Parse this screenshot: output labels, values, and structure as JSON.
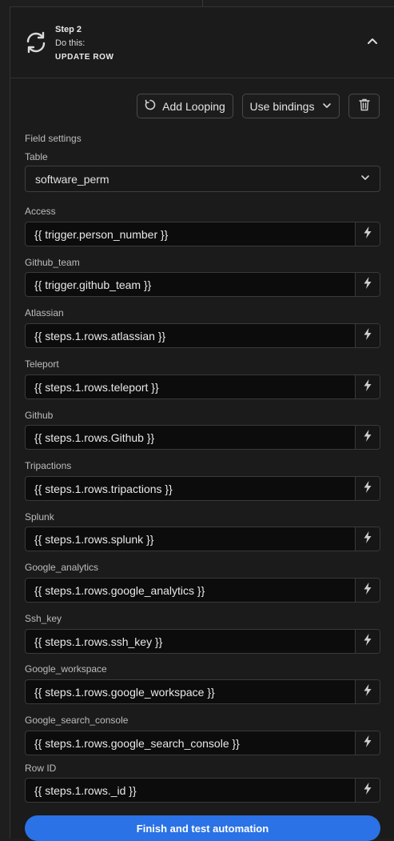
{
  "step": {
    "number_label": "Step 2",
    "do_label": "Do this:",
    "action_label": "UPDATE ROW",
    "icon": "refresh-icon",
    "collapse_icon": "chevron-up-icon"
  },
  "toolbar": {
    "looping_label": "Add Looping",
    "bindings_label": "Use bindings",
    "delete_icon": "trash-icon"
  },
  "settings": {
    "section_title": "Field settings",
    "table_label": "Table",
    "table_value": "software_perm"
  },
  "fields": [
    {
      "label": "Access",
      "value": "{{ trigger.person_number }}"
    },
    {
      "label": "Github_team",
      "value": "{{ trigger.github_team }}"
    },
    {
      "label": "Atlassian",
      "value": "{{ steps.1.rows.atlassian }}"
    },
    {
      "label": "Teleport",
      "value": "{{ steps.1.rows.teleport }}"
    },
    {
      "label": "Github",
      "value": "{{ steps.1.rows.Github }}"
    },
    {
      "label": "Tripactions",
      "value": "{{ steps.1.rows.tripactions }}"
    },
    {
      "label": "Splunk",
      "value": "{{ steps.1.rows.splunk }}"
    },
    {
      "label": "Google_analytics",
      "value": "{{ steps.1.rows.google_analytics }}"
    },
    {
      "label": "Ssh_key",
      "value": "{{ steps.1.rows.ssh_key }}"
    },
    {
      "label": "Google_workspace",
      "value": "{{ steps.1.rows.google_workspace }}"
    },
    {
      "label": "Google_search_console",
      "value": "{{ steps.1.rows.google_search_console }}"
    },
    {
      "label": "Row ID",
      "value": "{{ steps.1.rows._id }}"
    }
  ],
  "finish_label": "Finish and test automation",
  "colors": {
    "accent": "#2a72e5",
    "background": "#1b1b1b"
  }
}
